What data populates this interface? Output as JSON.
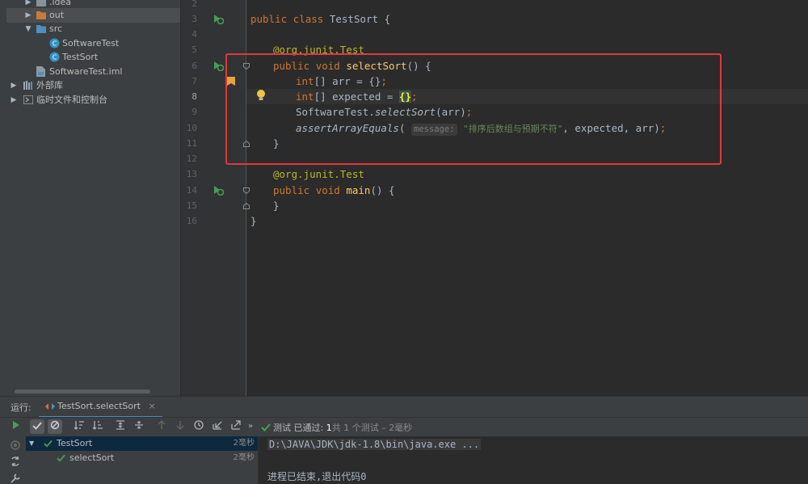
{
  "project_tree": {
    "items": [
      {
        "label": ".idea",
        "expanded": false
      },
      {
        "label": "out",
        "expanded": false
      },
      {
        "label": "src",
        "expanded": true
      },
      {
        "label": "SoftwareTest"
      },
      {
        "label": "TestSort"
      },
      {
        "label": "SoftwareTest.iml"
      },
      {
        "label": "外部库",
        "expanded": false
      },
      {
        "label": "临时文件和控制台",
        "expanded": false
      }
    ]
  },
  "editor": {
    "line_numbers": [
      "2",
      "3",
      "4",
      "5",
      "6",
      "7",
      "8",
      "9",
      "10",
      "11",
      "12",
      "13",
      "14",
      "15",
      "16"
    ],
    "code": {
      "l3_kw1": "public",
      "l3_kw2": "class",
      "l3_name": "TestSort",
      "l3_rest": "{",
      "l5_ann": "@org.junit.Test",
      "l6_kw1": "public",
      "l6_kw2": "void",
      "l6_fn": "selectSort",
      "l6_rest": "() {",
      "l7_kw": "int",
      "l7_rest": "[] arr = {}",
      "l7_semi": ";",
      "l8_kw": "int",
      "l8_rest": "[] expected = ",
      "l8_brace": "{}",
      "l8_semi": ";",
      "l9_cls": "SoftwareTest.",
      "l9_fn": "selectSort",
      "l9_rest": "(arr)",
      "l9_semi": ";",
      "l10_fn": "assertArrayEquals",
      "l10_open": "(",
      "l10_hint": "message:",
      "l10_str": "\"排序后数组与预期不符\"",
      "l10_rest": ", expected, arr)",
      "l10_semi": ";",
      "l11": "}",
      "l13_ann": "@org.junit.Test",
      "l14_kw1": "public",
      "l14_kw2": "void",
      "l14_fn": "main",
      "l14_rest": "() {",
      "l15": "}",
      "l16": "}"
    }
  },
  "run_panel": {
    "title": "运行:",
    "tab_label": "TestSort.selectSort",
    "tab_close": "×",
    "status": {
      "prefix": "测试 已通过: ",
      "count": "1",
      "suffix": "共 1 个测试 – 2毫秒"
    },
    "test_tree": [
      {
        "label": "TestSort",
        "duration": "2毫秒"
      },
      {
        "label": "selectSort",
        "duration": "2毫秒"
      }
    ],
    "console": {
      "command": "D:\\JAVA\\JDK\\jdk-1.8\\bin\\java.exe ...",
      "exit": "进程已结束,退出代码0"
    }
  },
  "colors": {
    "keyword": "#cc7832",
    "function": "#ffc66d",
    "annotation": "#bbb529",
    "string": "#6a8759",
    "pass": "#499c54",
    "highlight_box": "#e0393e"
  }
}
